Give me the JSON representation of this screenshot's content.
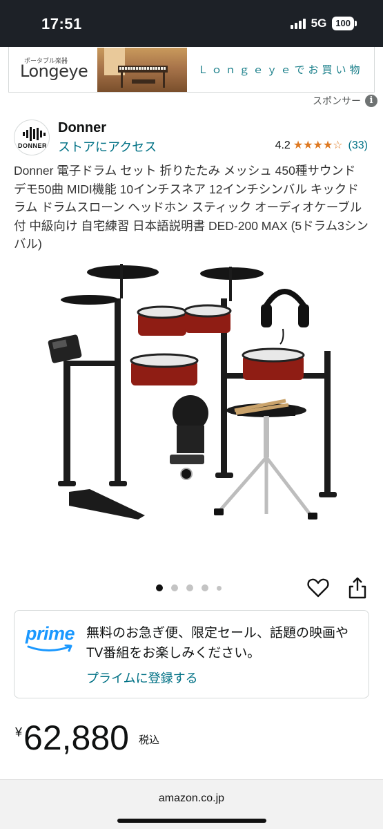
{
  "status_bar": {
    "time": "17:51",
    "network": "5G",
    "battery": "100"
  },
  "ad": {
    "logo_sub": "ポータブル楽器",
    "logo_main": "Longeye",
    "cta": "Ｌｏｎｇｅｙｅでお買い物",
    "sponsor_label": "スポンサー",
    "info_glyph": "i"
  },
  "brand": {
    "logo_text": "DONNER",
    "name": "Donner",
    "store_link": "ストアにアクセス",
    "rating": "4.2",
    "rating_stars": 4.2,
    "review_count": "(33)"
  },
  "product": {
    "title": "Donner 電子ドラム セット 折りたたみ メッシュ 450種サウンド デモ50曲 MIDI機能 10インチスネア 12インチシンバル キックドラム ドラムスローン ヘッドホン スティック オーディオケーブル付 中級向け 自宅練習 日本語説明書 DED-200 MAX (5ドラム3シンバル)",
    "image_count": 5,
    "active_image": 1
  },
  "prime": {
    "logo": "prime",
    "message": "無料のお急ぎ便、限定セール、話題の映画やTV番組をお楽しみください。",
    "link": "プライムに登録する"
  },
  "price": {
    "symbol": "¥",
    "value": "62,880",
    "tax_label": "税込"
  },
  "browser": {
    "domain": "amazon.co.jp"
  },
  "colors": {
    "link": "#007185",
    "star": "#de7921",
    "prime": "#1a98ff",
    "status_bg": "#1d2127"
  }
}
